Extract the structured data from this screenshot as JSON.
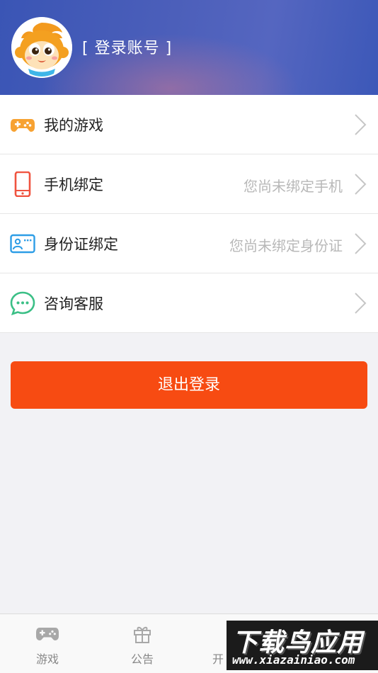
{
  "header": {
    "login_text": "[ 登录账号 ]"
  },
  "menu": [
    {
      "label": "我的游戏",
      "hint": "",
      "icon": "gamepad-icon"
    },
    {
      "label": "手机绑定",
      "hint": "您尚未绑定手机",
      "icon": "phone-icon"
    },
    {
      "label": "身份证绑定",
      "hint": "您尚未绑定身份证",
      "icon": "id-card-icon"
    },
    {
      "label": "咨询客服",
      "hint": "",
      "icon": "chat-icon"
    }
  ],
  "logout_label": "退出登录",
  "tabbar": [
    {
      "label": "游戏",
      "icon": "gamepad-icon"
    },
    {
      "label": "公告",
      "icon": "gift-icon"
    },
    {
      "label": "开",
      "icon": "server-icon"
    },
    {
      "label": "",
      "icon": "user-icon"
    }
  ],
  "watermark": {
    "cn": "下载鸟应用",
    "url": "www.xiazainiao.com"
  },
  "colors": {
    "accent": "#f74b12",
    "header_blue": "#4c5fba",
    "gamepad": "#f7a232",
    "phone": "#f0533f",
    "id_card": "#2d9de6",
    "chat": "#3bbf86"
  }
}
